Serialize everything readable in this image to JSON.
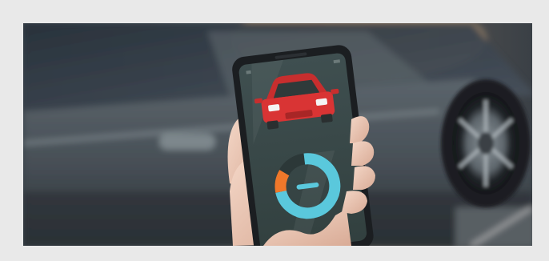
{
  "image": {
    "subject": "hand-holding-smartphone-car-app",
    "colors": {
      "frame": "#e9e9e9",
      "car_body": "#4a5258",
      "app_background": "#3a4a4a",
      "car_icon": "#d93434",
      "gauge_primary": "#5ac8dc",
      "gauge_secondary": "#f0782a"
    },
    "icons": [
      "car-front-icon",
      "battery-gauge-icon",
      "minus-icon"
    ],
    "gauge": {
      "primary_fraction": 0.82,
      "secondary_fraction": 0.18
    }
  }
}
